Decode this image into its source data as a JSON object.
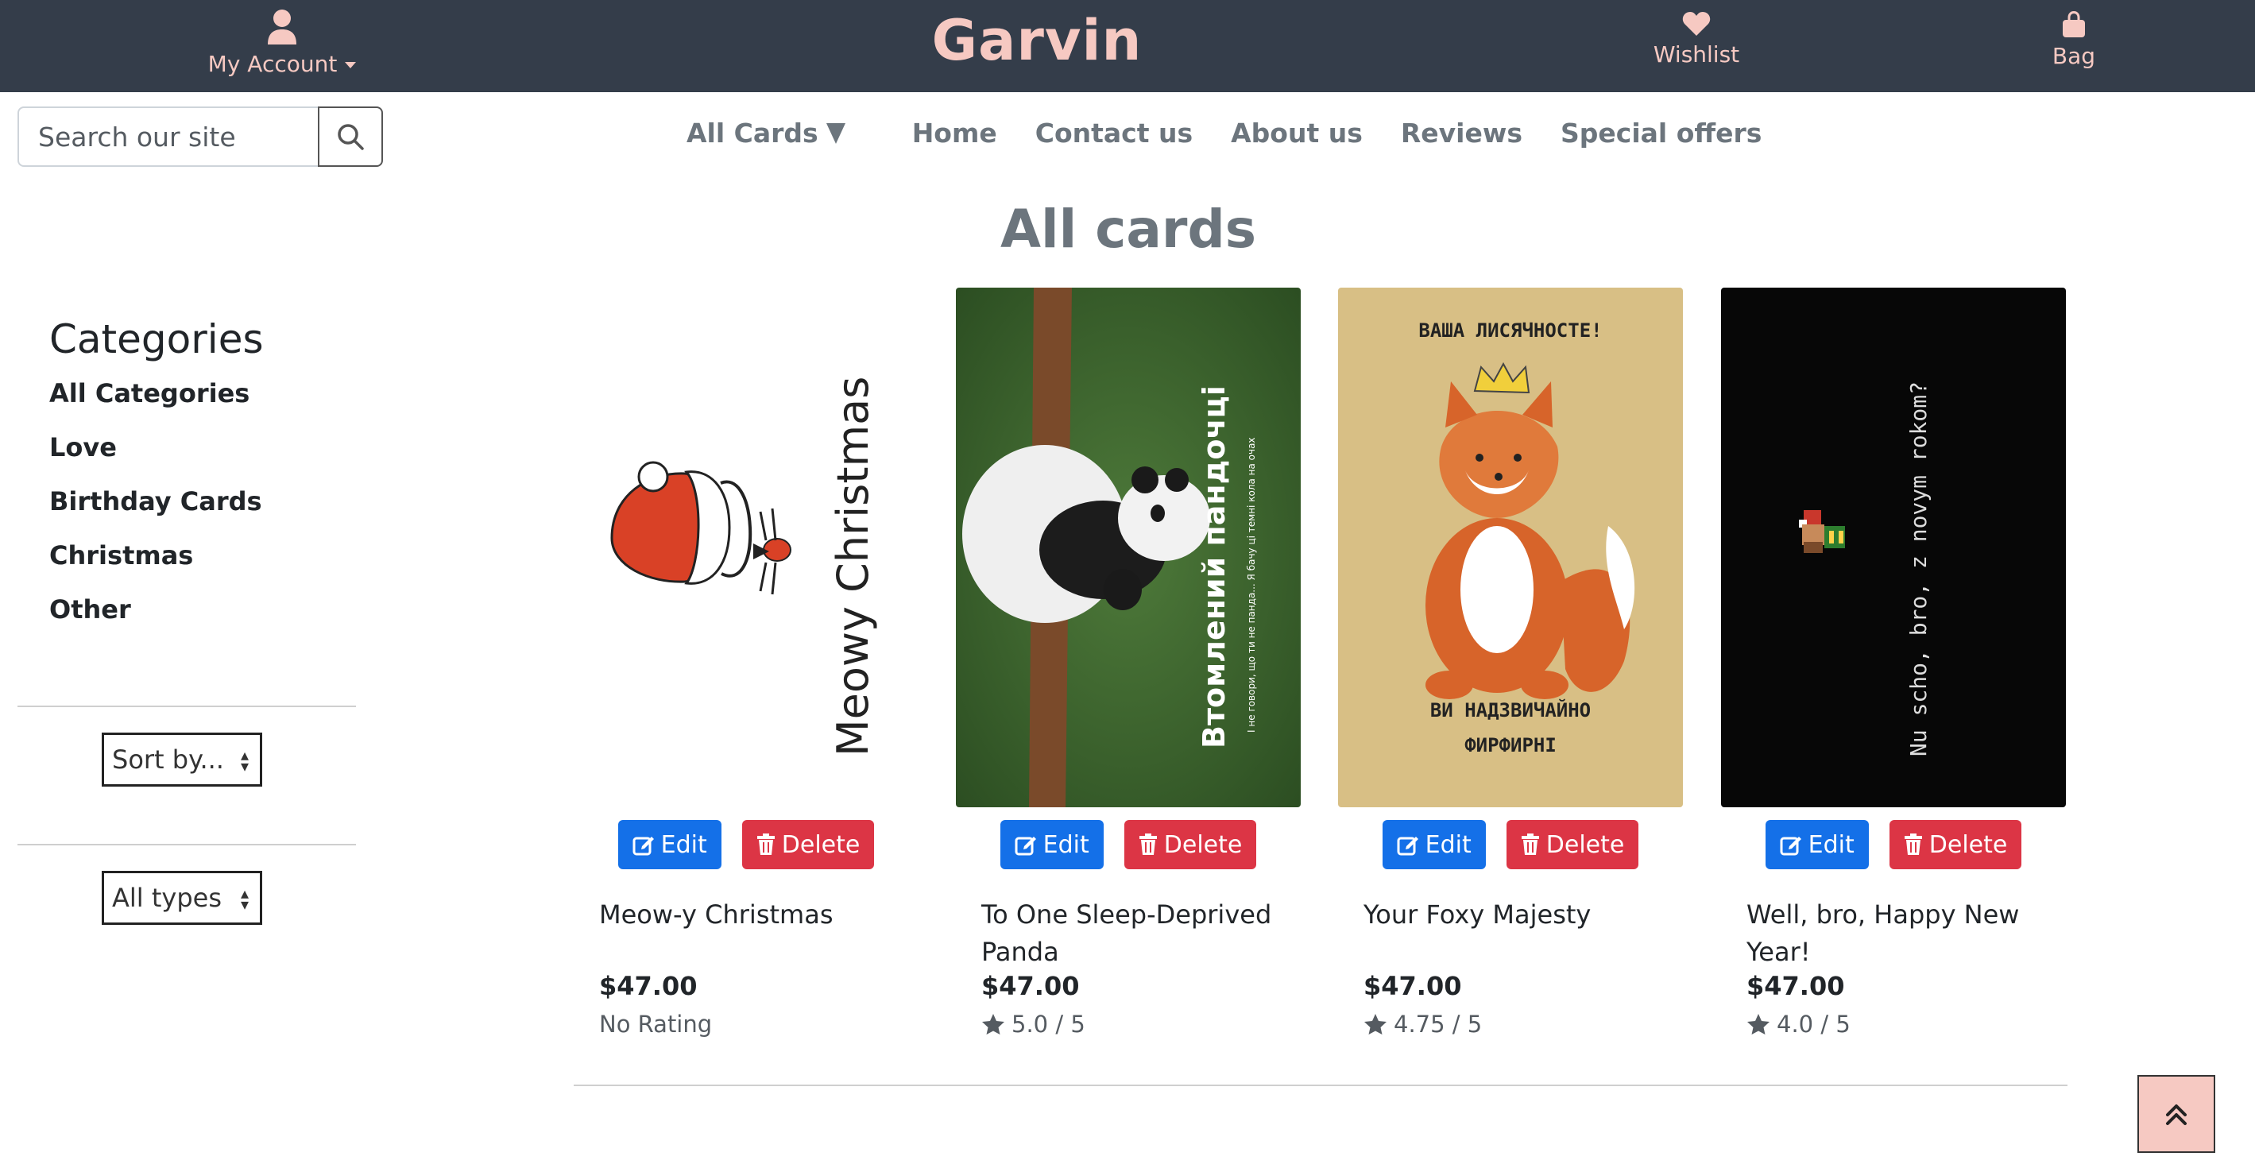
{
  "header": {
    "brand": "Garvin",
    "account_label": "My Account",
    "wishlist_label": "Wishlist",
    "bag_label": "Bag"
  },
  "search": {
    "placeholder": "Search our site"
  },
  "nav": {
    "all_cards": "All Cards",
    "items": [
      "Home",
      "Contact us",
      "About us",
      "Reviews",
      "Special offers"
    ]
  },
  "page_title": "All cards",
  "sidebar": {
    "title": "Categories",
    "categories": [
      "All Categories",
      "Love",
      "Birthday Cards",
      "Christmas",
      "Other"
    ],
    "sort_label": "Sort by...",
    "types_label": "All types"
  },
  "buttons": {
    "edit": "Edit",
    "delete": "Delete"
  },
  "cards": [
    {
      "name": "Meow-y Christmas",
      "price": "$47.00",
      "rating_text": "No Rating",
      "image_text": "Meowy Christmas"
    },
    {
      "name": "To One Sleep-Deprived Panda",
      "price": "$47.00",
      "rating_text": "5.0 / 5",
      "image_text": "Втомлений пандочці",
      "image_subtext": "І не говори, що ти не панда... Я бачу ці темні кола на очах"
    },
    {
      "name": "Your Foxy Majesty",
      "price": "$47.00",
      "rating_text": "4.75 / 5",
      "image_text_top": "ВАША ЛИСЯЧНОСТЕ!",
      "image_text_bottom_1": "ВИ НАДЗВИЧАЙНО",
      "image_text_bottom_2": "ФИРФИРНІ"
    },
    {
      "name": "Well, bro, Happy New Year!",
      "price": "$47.00",
      "rating_text": "4.0 / 5",
      "image_text": "Nu scho, bro, z novym rokom?"
    }
  ],
  "colors": {
    "header_bg": "#343d4a",
    "accent_pink": "#f6c9c2",
    "edit_blue": "#1470e8",
    "delete_red": "#dc3545"
  }
}
